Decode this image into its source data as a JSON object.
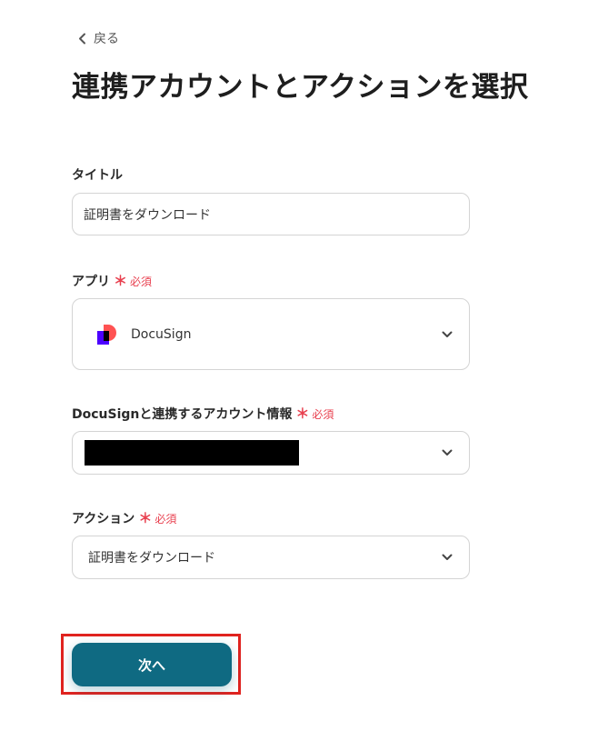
{
  "back": {
    "label": "戻る"
  },
  "page_title": "連携アカウントとアクションを選択",
  "required": {
    "mark": "＊",
    "text": "必須"
  },
  "fields": {
    "title": {
      "label": "タイトル",
      "value": "証明書をダウンロード"
    },
    "app": {
      "label": "アプリ",
      "value": "DocuSign",
      "icon": "docusign-logo"
    },
    "account": {
      "label": "DocuSignと連携するアカウント情報",
      "value_redacted": true
    },
    "action": {
      "label": "アクション",
      "value": "証明書をダウンロード"
    }
  },
  "next_button": {
    "label": "次へ"
  },
  "colors": {
    "primary": "#0f6a82",
    "required": "#e8404f",
    "highlight": "#e0231f",
    "logo_purple": "#4c00ff",
    "logo_red": "#ff5252"
  }
}
